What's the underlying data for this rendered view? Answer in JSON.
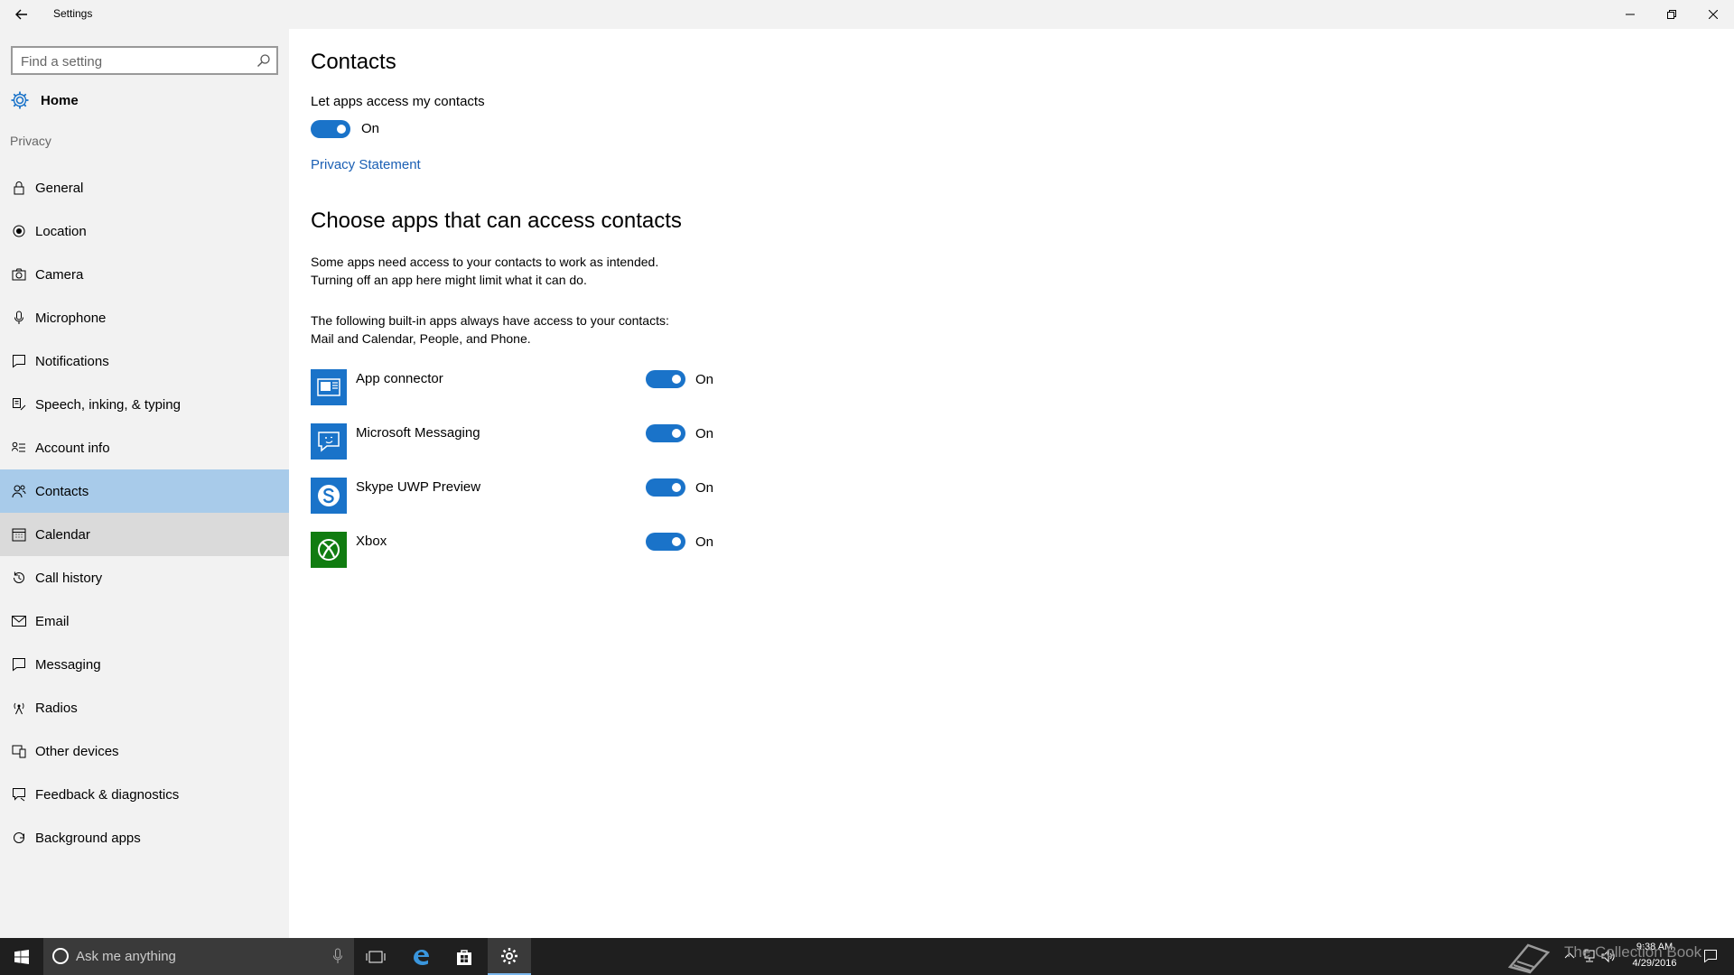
{
  "window": {
    "title": "Settings"
  },
  "sidebar": {
    "search_placeholder": "Find a setting",
    "home_label": "Home",
    "section_label": "Privacy",
    "items": [
      {
        "label": "General",
        "icon": "lock-icon"
      },
      {
        "label": "Location",
        "icon": "location-icon"
      },
      {
        "label": "Camera",
        "icon": "camera-icon"
      },
      {
        "label": "Microphone",
        "icon": "microphone-icon"
      },
      {
        "label": "Notifications",
        "icon": "notifications-icon"
      },
      {
        "label": "Speech, inking, & typing",
        "icon": "speech-icon"
      },
      {
        "label": "Account info",
        "icon": "account-info-icon"
      },
      {
        "label": "Contacts",
        "icon": "contacts-icon",
        "state": "selected"
      },
      {
        "label": "Calendar",
        "icon": "calendar-icon",
        "state": "hover"
      },
      {
        "label": "Call history",
        "icon": "history-icon"
      },
      {
        "label": "Email",
        "icon": "email-icon"
      },
      {
        "label": "Messaging",
        "icon": "messaging-icon"
      },
      {
        "label": "Radios",
        "icon": "radios-icon"
      },
      {
        "label": "Other devices",
        "icon": "devices-icon"
      },
      {
        "label": "Feedback & diagnostics",
        "icon": "feedback-icon"
      },
      {
        "label": "Background apps",
        "icon": "background-apps-icon"
      }
    ]
  },
  "main": {
    "title": "Contacts",
    "access_label": "Let apps access my contacts",
    "access_toggle_state": "On",
    "privacy_link": "Privacy Statement",
    "apps_heading": "Choose apps that can access contacts",
    "paragraph_1_line_1": "Some apps need access to your contacts to work as intended.",
    "paragraph_1_line_2": "Turning off an app here might limit what it can do.",
    "paragraph_2_line_1": "The following built-in apps always have access to your contacts:",
    "paragraph_2_line_2": "Mail and Calendar, People, and Phone.",
    "apps": [
      {
        "name": "App connector",
        "state": "On",
        "icon": "app-connector-icon",
        "color": "#1a73c9"
      },
      {
        "name": "Microsoft Messaging",
        "state": "On",
        "icon": "messaging-app-icon",
        "color": "#1a73c9"
      },
      {
        "name": "Skype UWP Preview",
        "state": "On",
        "icon": "skype-icon",
        "color": "#1a73c9"
      },
      {
        "name": "Xbox",
        "state": "On",
        "icon": "xbox-icon",
        "color": "#107c10"
      }
    ]
  },
  "taskbar": {
    "search_placeholder": "Ask me anything",
    "time": "9:38 AM",
    "date": "4/29/2016",
    "watermark": "The Collection Book"
  },
  "colors": {
    "accent": "#1a73c9",
    "selected_nav": "#a8cbea",
    "hover_nav": "#dadada",
    "sidebar_bg": "#f2f2f2",
    "taskbar_bg": "#1f1f1f"
  }
}
